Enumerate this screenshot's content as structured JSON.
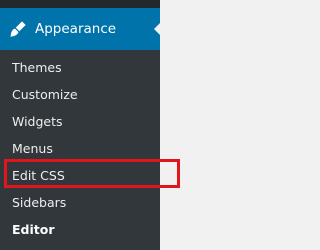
{
  "sidebar": {
    "section": {
      "label": "Appearance",
      "icon": "paintbrush-icon"
    },
    "items": [
      {
        "label": "Themes"
      },
      {
        "label": "Customize"
      },
      {
        "label": "Widgets"
      },
      {
        "label": "Menus"
      },
      {
        "label": "Edit CSS",
        "highlighted": true
      },
      {
        "label": "Sidebars"
      },
      {
        "label": "Editor",
        "current": true
      }
    ]
  },
  "colors": {
    "sidebar_bg": "#23282d",
    "submenu_bg": "#32373c",
    "active_bg": "#0073aa",
    "highlight": "#e0161f",
    "page_bg": "#f1f1f1"
  }
}
